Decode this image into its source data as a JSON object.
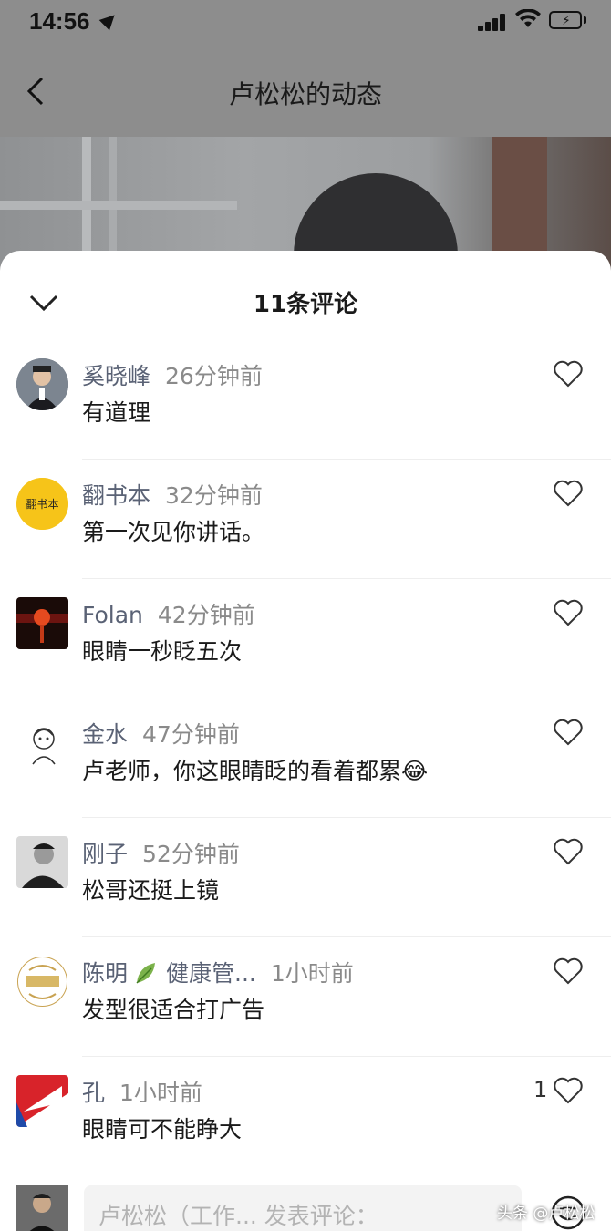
{
  "status_bar": {
    "time": "14:56"
  },
  "nav": {
    "title": "卢松松的动态"
  },
  "sheet": {
    "title": "11条评论"
  },
  "comments": [
    {
      "name": "奚晓峰",
      "time": "26分钟前",
      "text": "有道理",
      "likes": ""
    },
    {
      "name": "翻书本",
      "time": "32分钟前",
      "text": "第一次见你讲话。",
      "likes": "",
      "avatar_text": "翻书本"
    },
    {
      "name": "Folan",
      "time": "42分钟前",
      "text": "眼睛一秒眨五次",
      "likes": ""
    },
    {
      "name": "金水",
      "time": "47分钟前",
      "text": "卢老师，你这眼睛眨的看着都累",
      "likes": "",
      "emoji": "😂"
    },
    {
      "name": "刚子",
      "time": "52分钟前",
      "text": "松哥还挺上镜",
      "likes": ""
    },
    {
      "name": "陈明",
      "badge": "健康管...",
      "time": "1小时前",
      "text": "发型很适合打广告",
      "likes": ""
    },
    {
      "name": "孔",
      "time": "1小时前",
      "text": "眼睛可不能睁大",
      "likes": "1"
    }
  ],
  "input": {
    "placeholder": "卢松松（工作... 发表评论："
  },
  "watermark": "头条 @卢松松",
  "colors": {
    "accent_name": "#5a6275",
    "battery": "#35c759"
  }
}
